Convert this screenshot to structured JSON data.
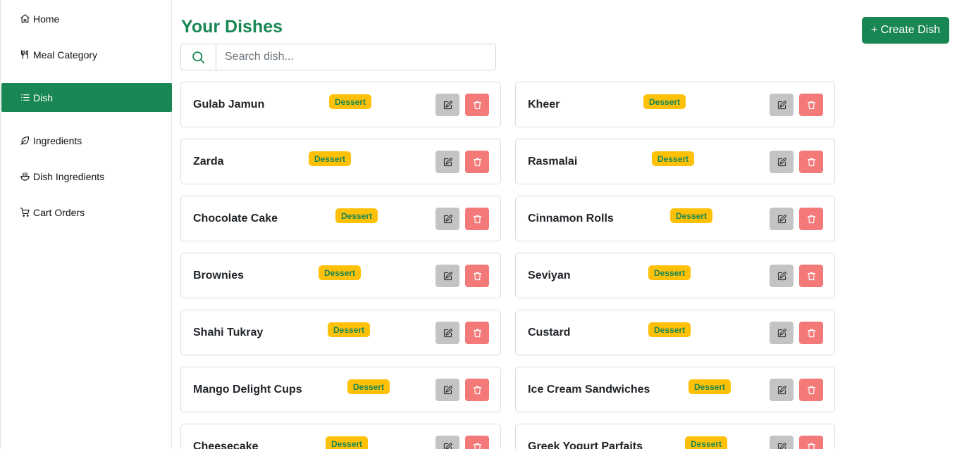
{
  "sidebar": {
    "items": [
      {
        "label": "Home",
        "icon": "home-icon",
        "active": false
      },
      {
        "label": "Meal Category",
        "icon": "utensils-icon",
        "active": false
      },
      {
        "label": "Dish",
        "icon": "list-icon",
        "active": true
      },
      {
        "label": "Ingredients",
        "icon": "leaf-icon",
        "active": false
      },
      {
        "label": "Dish Ingredients",
        "icon": "bowl-icon",
        "active": false
      },
      {
        "label": "Cart Orders",
        "icon": "cart-icon",
        "active": false
      }
    ]
  },
  "header": {
    "title": "Your Dishes",
    "create_label": "+ Create Dish"
  },
  "search": {
    "placeholder": "Search dish...",
    "value": ""
  },
  "dishes": [
    {
      "name": "Gulab Jamun",
      "category": "Dessert"
    },
    {
      "name": "Kheer",
      "category": "Dessert"
    },
    {
      "name": "Zarda",
      "category": "Dessert"
    },
    {
      "name": "Rasmalai",
      "category": "Dessert"
    },
    {
      "name": "Chocolate Cake",
      "category": "Dessert"
    },
    {
      "name": "Cinnamon Rolls",
      "category": "Dessert"
    },
    {
      "name": "Brownies",
      "category": "Dessert"
    },
    {
      "name": "Seviyan",
      "category": "Dessert"
    },
    {
      "name": "Shahi Tukray",
      "category": "Dessert"
    },
    {
      "name": "Custard",
      "category": "Dessert"
    },
    {
      "name": "Mango Delight Cups",
      "category": "Dessert"
    },
    {
      "name": "Ice Cream Sandwiches",
      "category": "Dessert"
    },
    {
      "name": "Cheesecake",
      "category": "Dessert"
    },
    {
      "name": "Greek Yogurt Parfaits",
      "category": "Dessert"
    }
  ],
  "colors": {
    "brand": "#198754",
    "badge": "#ffc107",
    "edit_button": "#c4c4c4",
    "delete_button": "#f47a7a"
  }
}
